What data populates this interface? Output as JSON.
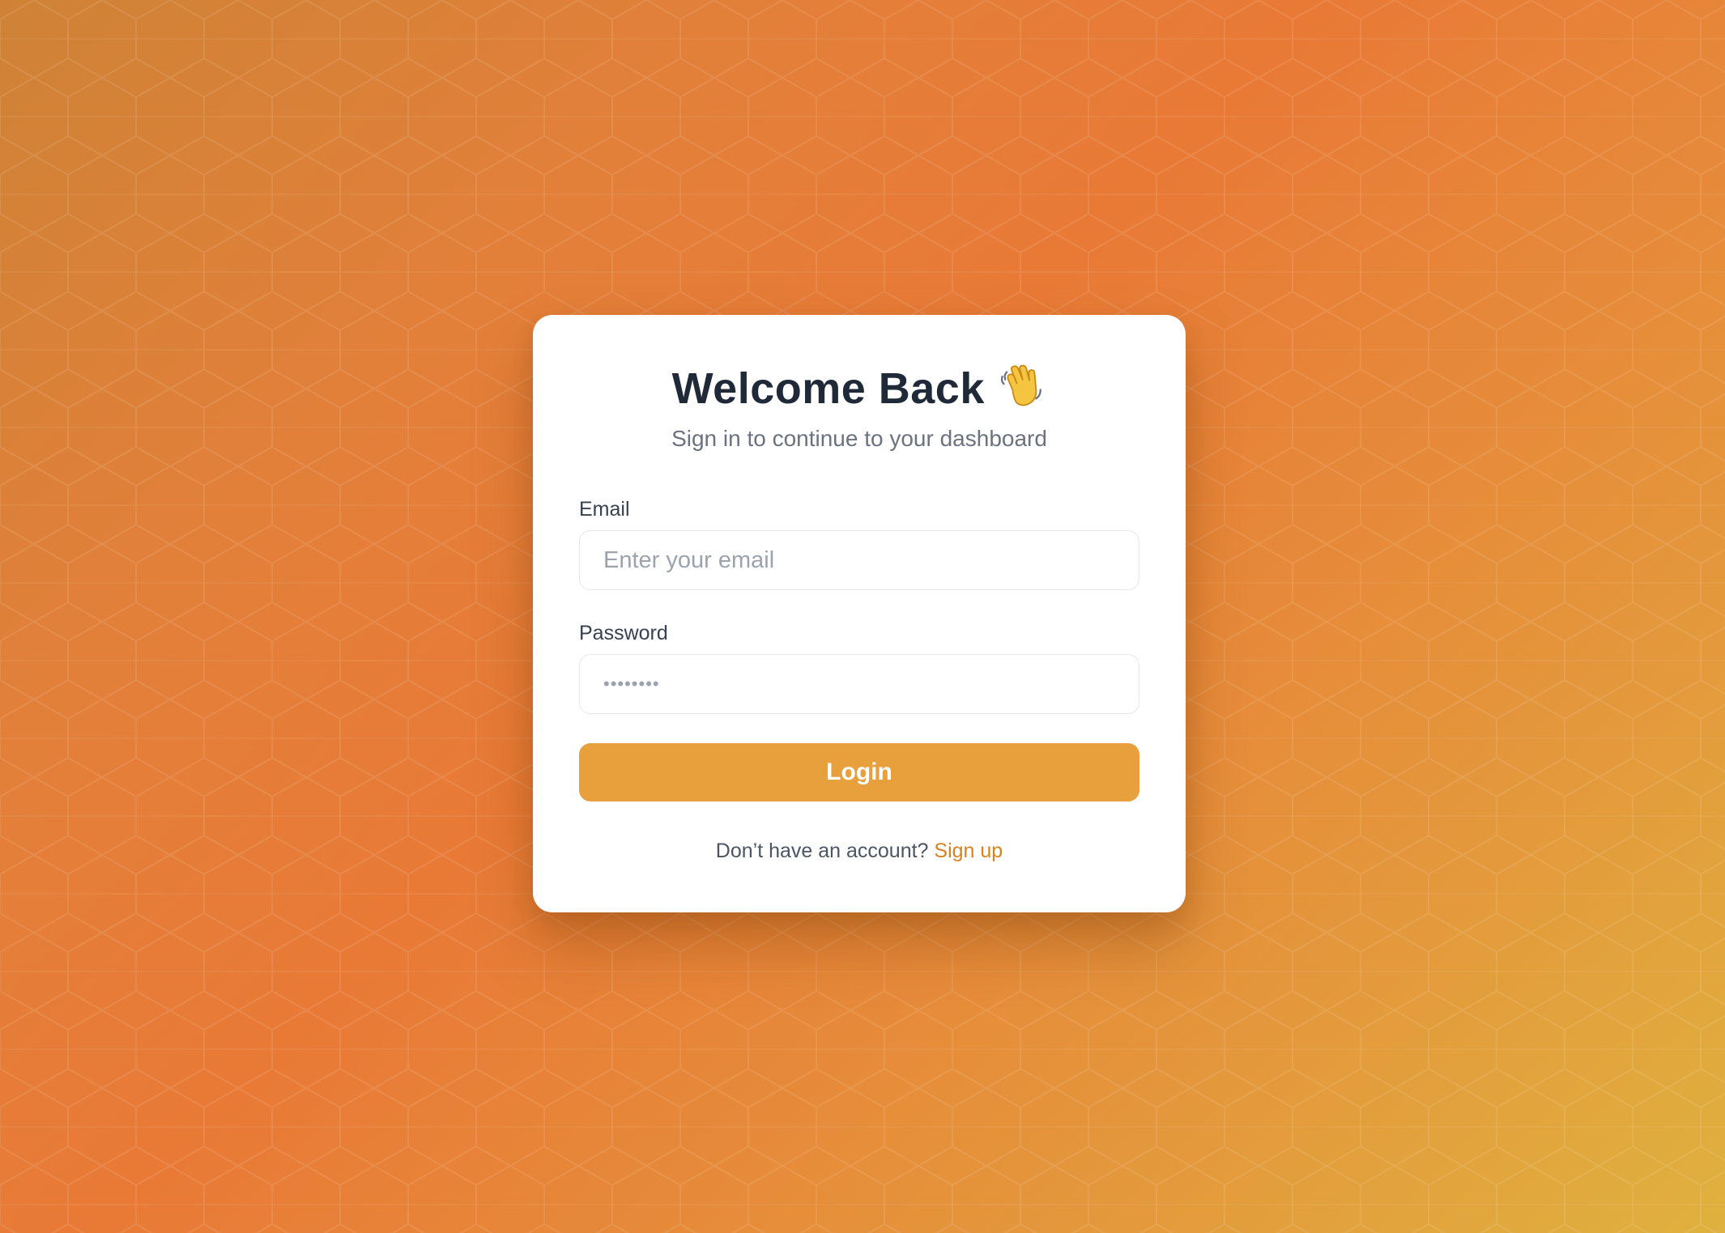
{
  "login": {
    "title": "Welcome Back",
    "title_icon": "waving-hand-icon",
    "subtitle": "Sign in to continue to your dashboard",
    "email": {
      "label": "Email",
      "placeholder": "Enter your email",
      "value": ""
    },
    "password": {
      "label": "Password",
      "placeholder": "••••••••",
      "value": ""
    },
    "submit_label": "Login",
    "footer_prompt": "Don’t have an account?",
    "signup_label": "Sign up"
  },
  "colors": {
    "accent": "#e8a03d",
    "link": "#d9821f",
    "title": "#1f2937",
    "background_start": "#cf8236",
    "background_mid": "#e87a36",
    "background_end": "#dfb13e"
  }
}
